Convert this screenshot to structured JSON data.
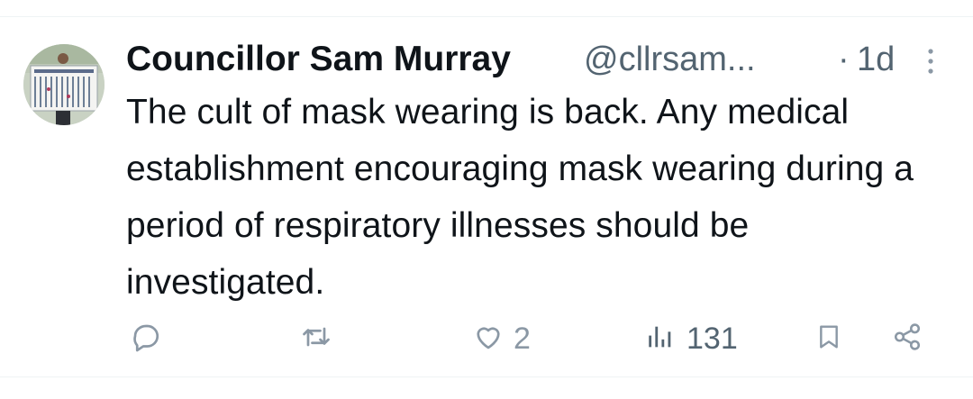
{
  "tweet": {
    "display_name": "Councillor Sam Murray",
    "handle": "@cllrsam...",
    "separator": "·",
    "time": "1d",
    "text": "The cult of mask wearing is back. Any medical establishment encouraging mask wearing during a period of respiratory illnesses should be investigated."
  },
  "actions": {
    "reply": {
      "icon": "reply-icon",
      "count": ""
    },
    "repost": {
      "icon": "repost-icon",
      "count": ""
    },
    "like": {
      "icon": "heart-icon",
      "count": "2"
    },
    "views": {
      "icon": "views-icon",
      "count": "131"
    },
    "bookmark": {
      "icon": "bookmark-icon"
    },
    "share": {
      "icon": "share-icon"
    }
  },
  "colors": {
    "primary_text": "#0f1419",
    "secondary_text": "#536471",
    "icon_gray": "#8b98a5",
    "divider": "#eff3f4"
  }
}
